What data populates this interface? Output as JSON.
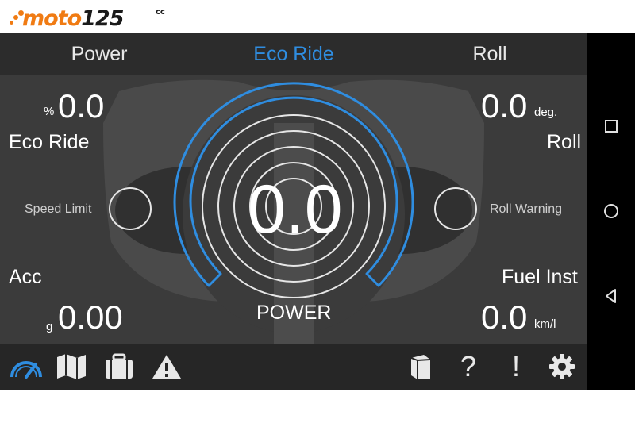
{
  "logo": {
    "brand_text": "moto",
    "brand_number": "125",
    "brand_suffix": "cc"
  },
  "tabs": [
    {
      "label": "Power",
      "active": false
    },
    {
      "label": "Eco Ride",
      "active": true
    },
    {
      "label": "Roll",
      "active": false
    }
  ],
  "gauges": {
    "top_left": {
      "value": "0.0",
      "unit": "%",
      "label": "Eco Ride"
    },
    "top_right": {
      "value": "0.0",
      "unit": "deg.",
      "label": "Roll"
    },
    "bottom_left": {
      "value": "0.00",
      "unit": "g",
      "label": "Acc"
    },
    "bottom_right": {
      "value": "0.0",
      "unit": "km/l",
      "label": "Fuel Inst"
    },
    "center": {
      "value": "0.0",
      "label": "POWER"
    },
    "speed_limit_label": "Speed Limit",
    "roll_warning_label": "Roll Warning"
  },
  "bottom_bar": {
    "left_icons": [
      "speedometer-icon",
      "map-icon",
      "briefcase-icon",
      "warning-icon"
    ],
    "right_icons": [
      "book-icon",
      "help-icon",
      "alert-icon",
      "settings-icon"
    ],
    "help_glyph": "?",
    "alert_glyph": "!"
  },
  "android_nav": [
    "recents-button",
    "home-button",
    "back-button"
  ],
  "colors": {
    "accent": "#2f8de0",
    "logo_orange": "#f07b13",
    "screen_bg": "#3a3a3a",
    "bar_bg": "#2c2c2c"
  }
}
